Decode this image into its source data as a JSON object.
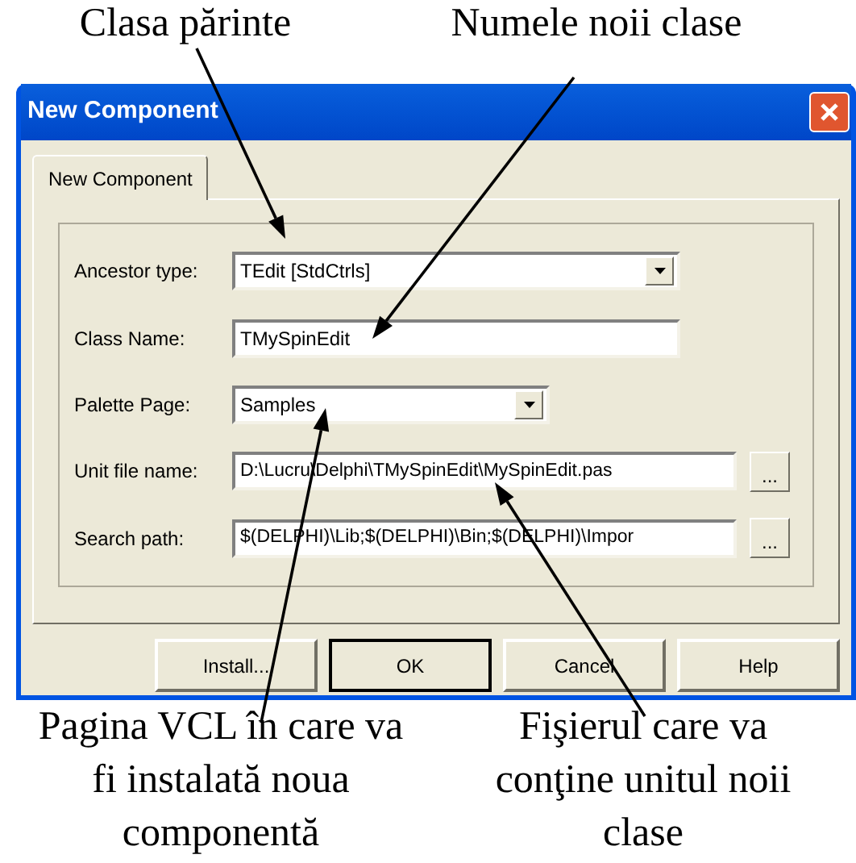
{
  "top_annotations": [
    "Clasa părinte",
    "Numele noii clase"
  ],
  "window": {
    "title": "New Component"
  },
  "tabs": [
    {
      "label": "New Component",
      "selected": true
    }
  ],
  "fields": [
    {
      "label": "Ancestor type:",
      "value": "TEdit  [StdCtrls]",
      "kind": "combo"
    },
    {
      "label": "Class Name:",
      "value": "TMySpinEdit",
      "kind": "edit"
    },
    {
      "label": "Palette Page:",
      "value": "Samples",
      "kind": "shortcombo"
    },
    {
      "label": "Unit file name:",
      "value": "D:\\Lucru\\Delphi\\TMySpinEdit\\MySpinEdit.pas",
      "kind": "browse",
      "browse_label": "..."
    },
    {
      "label": "Search path:",
      "value": "$(DELPHI)\\Lib;$(DELPHI)\\Bin;$(DELPHI)\\Impor",
      "kind": "browse",
      "browse_label": "..."
    }
  ],
  "buttons": [
    {
      "label": "Install...",
      "default": false
    },
    {
      "label": "OK",
      "default": true
    },
    {
      "label": "Cancel",
      "default": false
    },
    {
      "label": "Help",
      "default": false
    }
  ],
  "bottom_annotations": [
    "Pagina VCL în care va fi instalată noua componentă",
    "Fişierul care va conţine unitul noii clase"
  ]
}
